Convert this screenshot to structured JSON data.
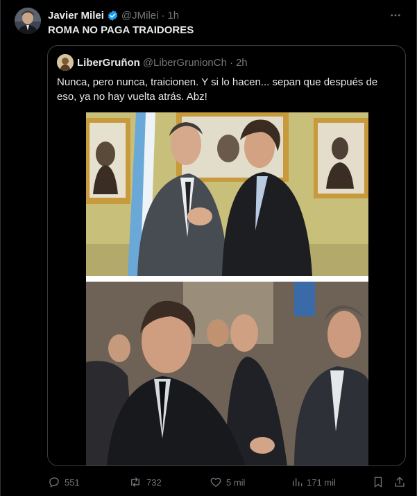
{
  "tweet": {
    "display_name": "Javier Milei",
    "handle": "@JMilei",
    "separator": "·",
    "time": "1h",
    "text": "ROMA NO PAGA TRAIDORES"
  },
  "quoted": {
    "display_name": "LiberGruñon",
    "handle": "@LiberGrunionCh",
    "separator": "·",
    "time": "2h",
    "text": "Nunca, pero nunca, traicionen. Y si lo hacen... sepan que después de eso, ya no hay vuelta atrás. Abz!"
  },
  "actions": {
    "replies": "551",
    "retweets": "732",
    "likes": "5 mil",
    "views": "171 mil"
  },
  "icons": {
    "verified": "verified-badge-icon",
    "more": "more-options-icon",
    "reply": "reply-icon",
    "retweet": "retweet-icon",
    "like": "heart-icon",
    "views": "views-icon",
    "bookmark": "bookmark-icon",
    "share": "share-icon"
  },
  "colors": {
    "background": "#000000",
    "text_primary": "#e7e9ea",
    "text_secondary": "#71767b",
    "verified": "#1d9bf0",
    "border": "#2f3336"
  }
}
